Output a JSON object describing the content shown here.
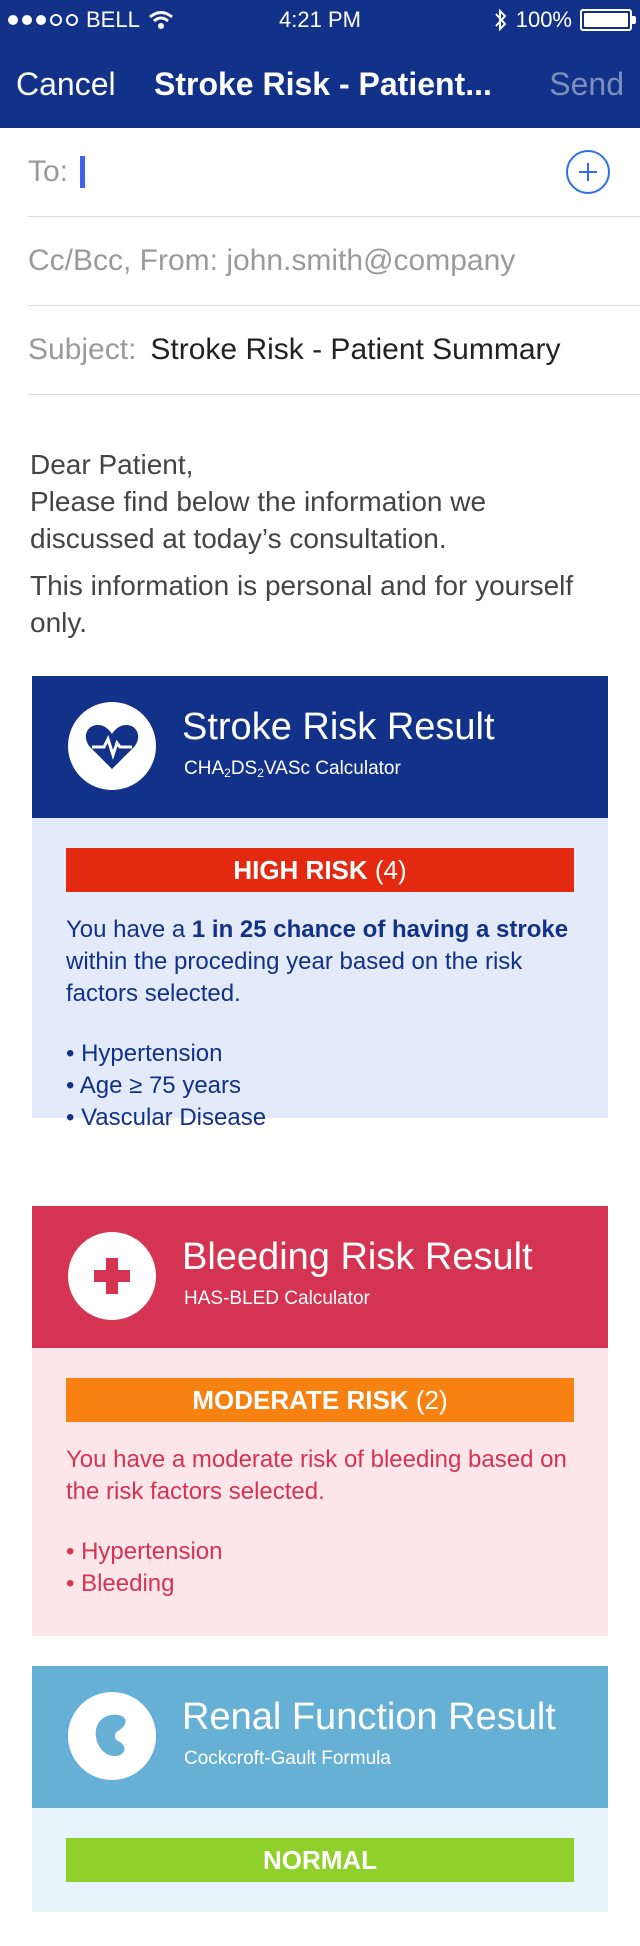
{
  "status_bar": {
    "carrier": "BELL",
    "time": "4:21 PM",
    "battery": "100%"
  },
  "nav": {
    "cancel_label": "Cancel",
    "title": "Stroke Risk - Patient...",
    "send_label": "Send"
  },
  "mail": {
    "to_label": "To:",
    "cc_bcc_from": "Cc/Bcc, From: john.smith@company",
    "subject_label": "Subject:",
    "subject_value": "Stroke Risk - Patient Summary"
  },
  "body": {
    "greeting": "Dear Patient,",
    "intro": "Please find below the information we discussed at today’s consultation.",
    "privacy": "This information is personal and for yourself only."
  },
  "cards": {
    "stroke": {
      "title": "Stroke Risk Result",
      "subtitle_parts": [
        "CHA",
        "2",
        "DS",
        "2",
        "VASc Calculator"
      ],
      "risk_label": "HIGH RISK",
      "risk_score": "(4)",
      "desc_prefix": "You have a ",
      "desc_bold": "1 in 25 chance of having a stroke",
      "desc_suffix": " within the proceding year based on the risk factors selected.",
      "factors": [
        "Hypertension",
        "Age ≥ 75 years",
        "Vascular Disease"
      ],
      "icon": "heart-pulse-icon"
    },
    "bleeding": {
      "title": "Bleeding Risk Result",
      "subtitle": "HAS-BLED Calculator",
      "risk_label": "MODERATE RISK",
      "risk_score": "(2)",
      "desc": "You have a moderate risk of bleeding based on the risk factors selected.",
      "factors": [
        "Hypertension",
        "Bleeding"
      ],
      "icon": "cross-icon"
    },
    "renal": {
      "title": "Renal Function Result",
      "subtitle": "Cockcroft-Gault Formula",
      "risk_label": "NORMAL",
      "icon": "kidney-icon"
    }
  },
  "colors": {
    "nav_bg": "#123189",
    "stroke_head": "#123189",
    "stroke_body": "#e3eaf9",
    "high_risk": "#e3290f",
    "bleed_head": "#d53352",
    "bleed_body": "#fce6ea",
    "moderate_risk": "#f78212",
    "renal_head": "#66b0d6",
    "renal_body": "#e6f3fb",
    "normal": "#8fd12a"
  }
}
